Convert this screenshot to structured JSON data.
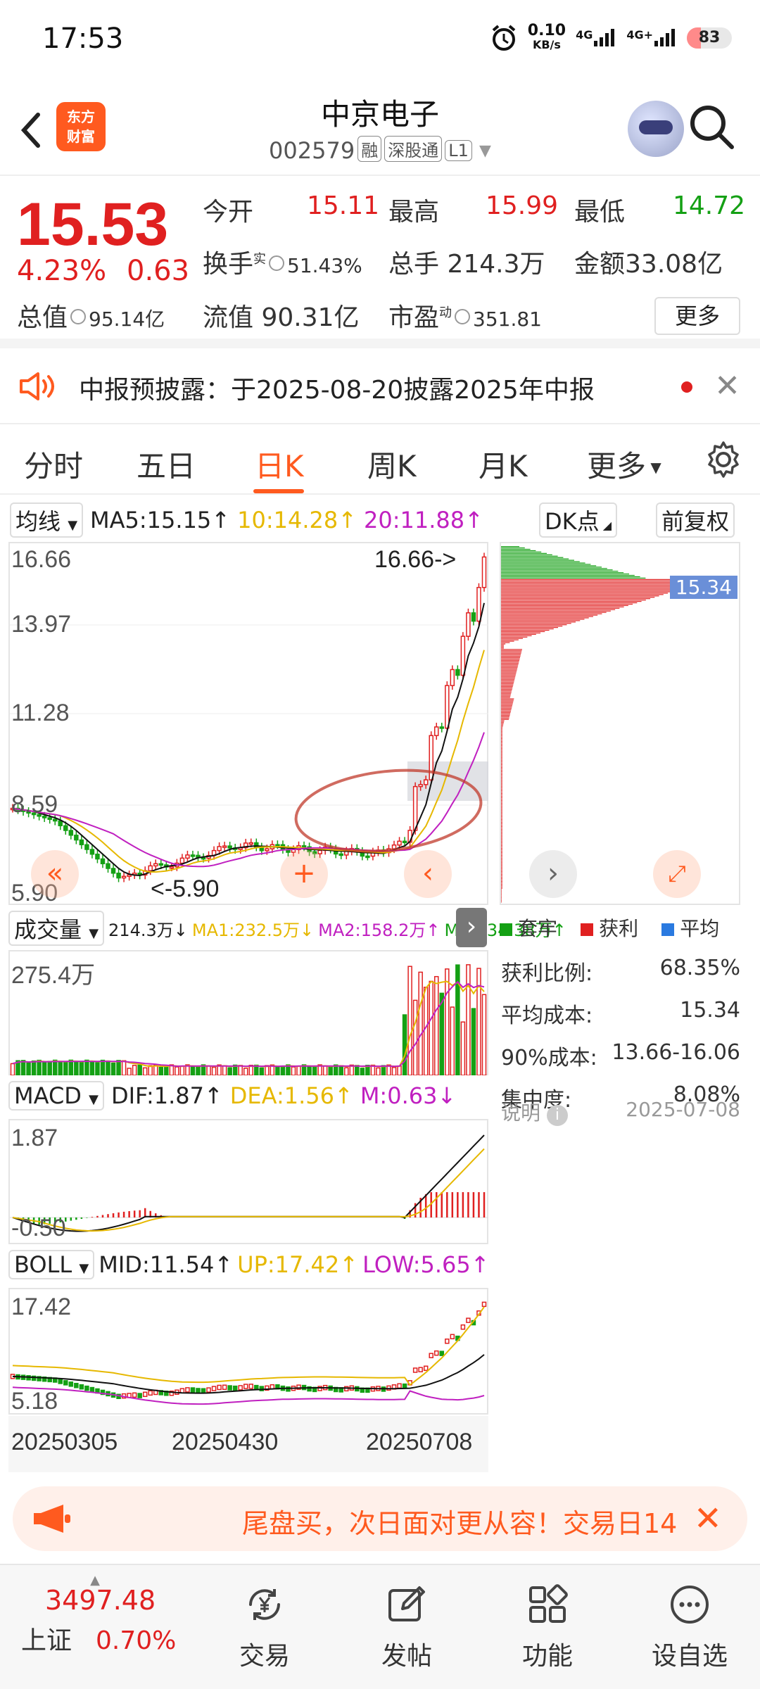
{
  "status_bar": {
    "time": "17:53",
    "net_speed_value": "0.10",
    "net_speed_unit": "KB/s",
    "signal1": "4G",
    "signal2": "4G+",
    "battery": "83"
  },
  "header": {
    "logo_line1": "东方",
    "logo_line2": "财富",
    "title": "中京电子",
    "code": "002579",
    "tags": [
      "融",
      "深股通",
      "L1"
    ]
  },
  "quote": {
    "price": "15.53",
    "change_pct": "4.23%",
    "change": "0.63",
    "open_label": "今开",
    "open": "15.11",
    "high_label": "最高",
    "high": "15.99",
    "low_label": "最低",
    "low": "14.72",
    "turnover_label": "换手",
    "turnover_sup": "实",
    "turnover": "51.43%",
    "volume_label": "总手",
    "volume": "214.3万",
    "amount_label": "金额",
    "amount": "33.08亿",
    "mktcap_label": "总值",
    "mktcap": "95.14亿",
    "float_label": "流值",
    "float": "90.31亿",
    "pe_label": "市盈",
    "pe_sup": "动",
    "pe": "351.81",
    "more_label": "更多"
  },
  "notice": {
    "text": "中报预披露：于2025-08-20披露2025年中报"
  },
  "tabs": [
    "分时",
    "五日",
    "日K",
    "周K",
    "月K",
    "更多"
  ],
  "kline": {
    "ma_selector": "均线",
    "ma5": "MA5:15.15",
    "ma10": "10:14.28",
    "ma20": "20:11.88",
    "dk_button": "DK点",
    "adjust_button": "前复权",
    "y_labels": [
      "16.66",
      "13.97",
      "11.28",
      "8.59",
      "5.90"
    ],
    "high_marker": "16.66->",
    "low_marker": "<-5.90",
    "chip_price": "15.34"
  },
  "volume": {
    "selector": "成交量",
    "value": "214.3万",
    "ma1": "MA1:232.5万",
    "ma2": "MA2:158.2万",
    "ma3": "MA3:34.38万",
    "y_max": "275.4万"
  },
  "macd": {
    "selector": "MACD",
    "dif": "DIF:1.87",
    "dea": "DEA:1.56",
    "m": "M:0.63",
    "y_max": "1.87",
    "y_min": "-0.50"
  },
  "boll": {
    "selector": "BOLL",
    "mid": "MID:11.54",
    "up": "UP:17.42",
    "low": "LOW:5.65",
    "y_max": "17.42",
    "y_min": "5.18",
    "dates": [
      "20250305",
      "20250430",
      "20250708"
    ]
  },
  "chips": {
    "legend": [
      "套牢",
      "获利",
      "平均"
    ],
    "rows": [
      {
        "label": "获利比例:",
        "value": "68.35%"
      },
      {
        "label": "平均成本:",
        "value": "15.34"
      },
      {
        "label": "90%成本:",
        "value": "13.66-16.06"
      },
      {
        "label": "集中度:",
        "value": "8.08%"
      }
    ],
    "note_label": "说明",
    "date": "2025-07-08"
  },
  "ad": {
    "text": "尾盘买，次日面对更从容！交易日14"
  },
  "nav": {
    "index_value": "3497.48",
    "index_name": "上证",
    "index_pct": "0.70%",
    "items": [
      "交易",
      "发帖",
      "功能",
      "设自选"
    ]
  },
  "colors": {
    "up": "#e02020",
    "down": "#14a014",
    "accent": "#ff5a1f",
    "ma10": "#e6b800",
    "ma20": "#c020c0"
  }
}
